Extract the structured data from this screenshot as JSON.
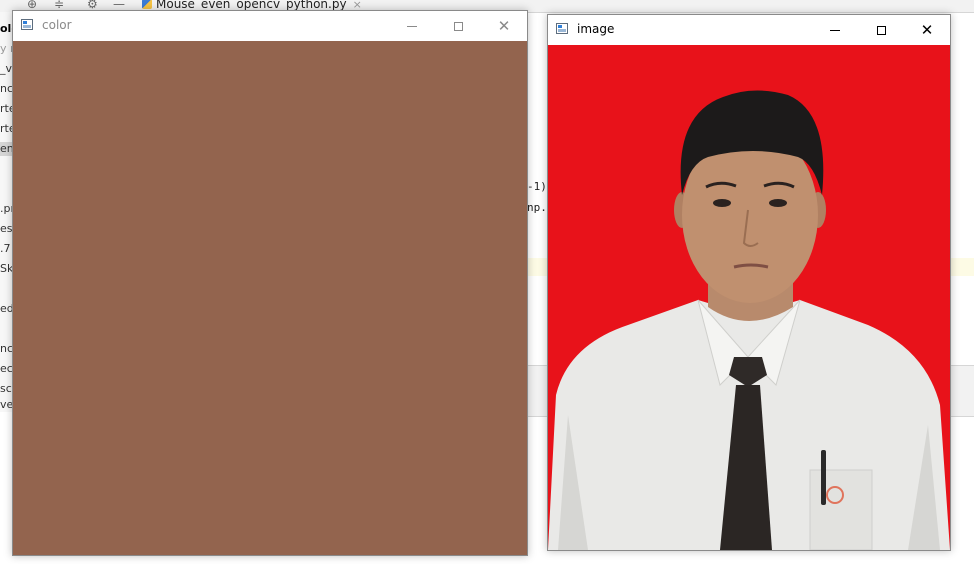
{
  "ide": {
    "tab_label": "Mouse_even_opencv_python.py",
    "tab_close": "×",
    "project_items": [
      "ole",
      "y n",
      "_vi",
      "nc",
      "rte",
      "rte",
      "en_",
      ".pr",
      "es",
      ".7",
      "Ske",
      "ed",
      "nc",
      "ec",
      "scr",
      "ver"
    ],
    "editor_fragments": [
      "-1)",
      "np.u"
    ]
  },
  "windows": {
    "color": {
      "title": "color",
      "fill_color": "#93644e",
      "state": "inactive"
    },
    "image": {
      "title": "image",
      "state": "active",
      "content": "ID photo portrait of a young man in a white shirt and dark tie on a red background"
    }
  },
  "colors": {
    "swatch": "#93644e",
    "photo_background": "#e8121a"
  }
}
